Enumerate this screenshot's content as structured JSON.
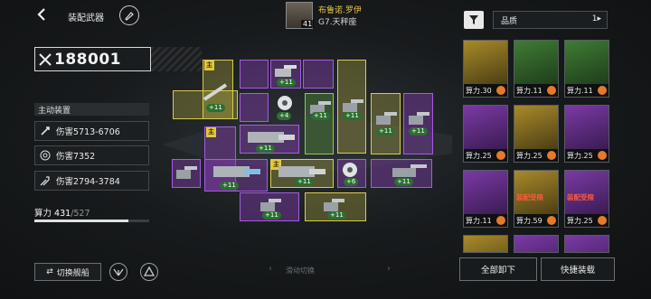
{
  "header": {
    "back_icon": "chevron-left-icon",
    "title": "装配武器",
    "edit_icon": "pencil-icon"
  },
  "commander": {
    "name": "布鲁诺.罗伊",
    "sub": "G7.天秤座",
    "level": "41"
  },
  "filter": {
    "icon": "filter-icon",
    "quality_label": "品质",
    "quality_arrow": "1▸"
  },
  "power": {
    "value": "188001",
    "icon": "crossed-swords-icon"
  },
  "active_section": "主动装置",
  "stats": [
    {
      "icon": "missile-icon",
      "label": "伤害5713-6706"
    },
    {
      "icon": "target-icon",
      "label": "伤害7352"
    },
    {
      "icon": "cluster-missile-icon",
      "label": "伤害2794-3784"
    }
  ],
  "compute": {
    "label": "算力",
    "current": "431",
    "max": "/527",
    "fraction": 0.818
  },
  "bottom_left": {
    "switch_ship": "切换舰船",
    "slide_hint": "滑动切换"
  },
  "grid": {
    "main_tag": "主",
    "pills": [
      "+11",
      "+11",
      "+4",
      "+11",
      "+11",
      "+11",
      "+11",
      "+11",
      "+11",
      "+6",
      "+11",
      "+11",
      "+11",
      "+11"
    ]
  },
  "inventory": [
    {
      "rarity": "gold",
      "value": "算力.30",
      "warn": ""
    },
    {
      "rarity": "green",
      "value": "算力.11",
      "warn": ""
    },
    {
      "rarity": "green",
      "value": "算力.11",
      "warn": ""
    },
    {
      "rarity": "purple",
      "value": "算力.25",
      "warn": ""
    },
    {
      "rarity": "gold",
      "value": "算力.25",
      "warn": ""
    },
    {
      "rarity": "purple",
      "value": "算力.25",
      "warn": ""
    },
    {
      "rarity": "purple",
      "value": "算力.11",
      "warn": ""
    },
    {
      "rarity": "gold",
      "value": "算力.59",
      "warn": "装配受限"
    },
    {
      "rarity": "purple",
      "value": "算力.25",
      "warn": "装配受限"
    }
  ],
  "actions": {
    "unload_all": "全部卸下",
    "quick_equip": "快捷装载"
  }
}
